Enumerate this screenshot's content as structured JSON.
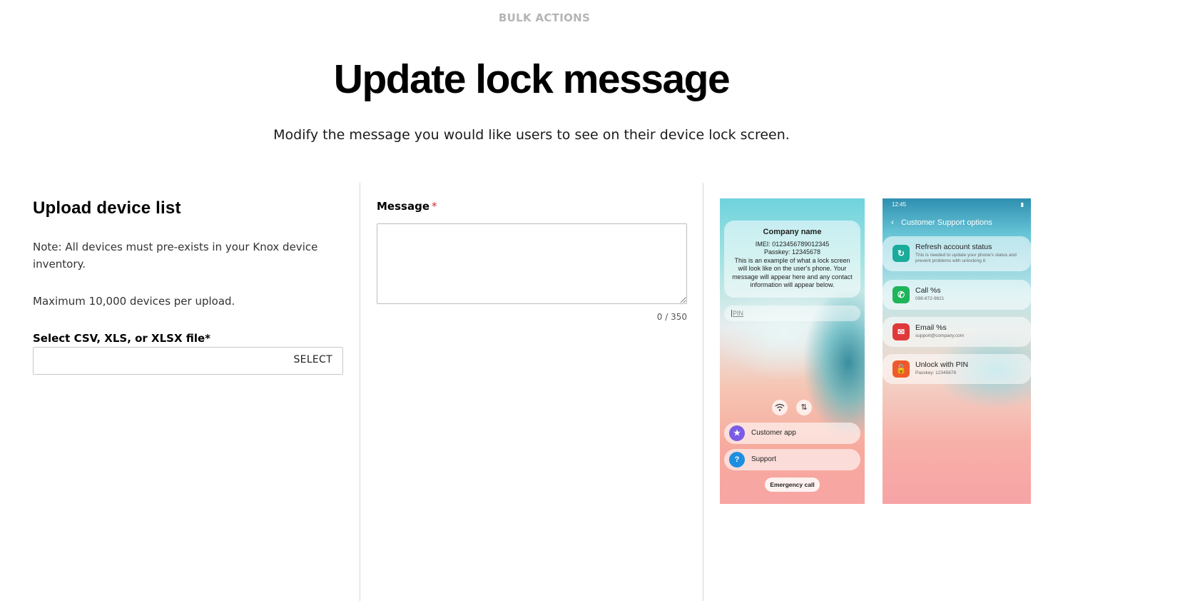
{
  "header": {
    "eyebrow": "BULK ACTIONS",
    "title": "Update lock message",
    "subtitle": "Modify the message you would like users to see on their device lock screen."
  },
  "upload": {
    "title": "Upload device list",
    "note": "Note: All devices must pre-exists in your Knox device inventory.",
    "max_note": "Maximum 10,000 devices per upload.",
    "file_label": "Select CSV, XLS, or XLSX file*",
    "file_value": "",
    "select_button": "SELECT"
  },
  "message": {
    "label": "Message",
    "required_mark": "*",
    "value": "",
    "counter": "0 / 350"
  },
  "preview_lock": {
    "company_name": "Company name",
    "imei": "IMEI: 0123456789012345",
    "passkey": "Passkey: 12345678",
    "example_text": "This is an example of what a lock screen will look like on the user's phone. Your message will appear here and any contact information will appear below.",
    "pin_placeholder": "PIN",
    "apps": [
      {
        "label": "Customer app",
        "icon": "star-icon",
        "color": "#7b5ce6"
      },
      {
        "label": "Support",
        "icon": "question-icon",
        "color": "#1e8fe0"
      }
    ],
    "emergency": "Emergency call"
  },
  "preview_support": {
    "time": "12:45",
    "header": "Customer Support options",
    "options": [
      {
        "title": "Refresh account status",
        "sub": "This is needed to update your phone's status and prevent problems with unlocking it.",
        "icon": "refresh-icon",
        "color": "#1aab9b"
      },
      {
        "title": "Call %s",
        "sub": "098-872-9821",
        "icon": "phone-icon",
        "color": "#1fb35a"
      },
      {
        "title": "Email %s",
        "sub": "support@company.com",
        "icon": "mail-icon",
        "color": "#e0393a"
      },
      {
        "title": "Unlock with PIN",
        "sub": "Passkey: 12345678",
        "icon": "lock-icon",
        "color": "#ef5a2a"
      }
    ]
  }
}
